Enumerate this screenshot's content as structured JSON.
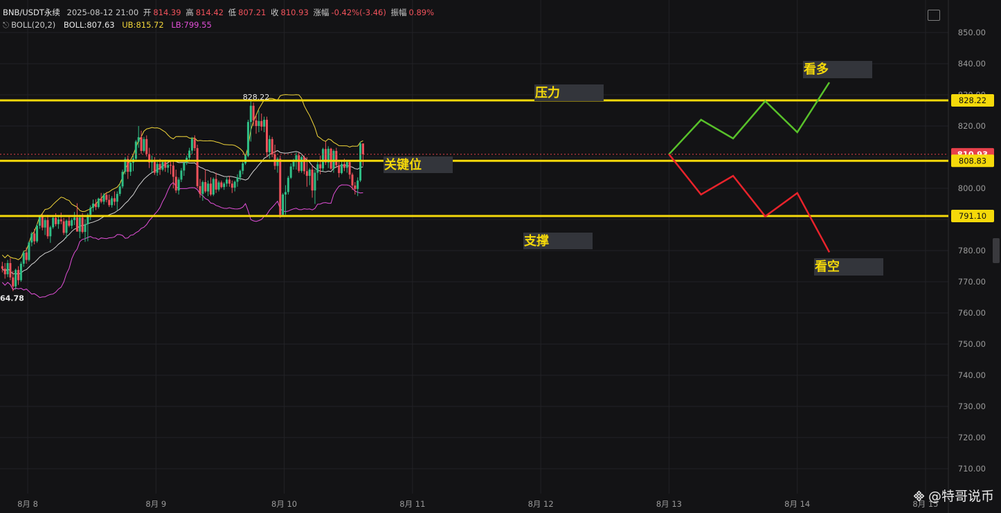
{
  "header": {
    "symbol": "BNB/USDT永续",
    "datetime": "2025-08-12 21:00",
    "open_label": "开",
    "open_value": "814.39",
    "high_label": "高",
    "high_value": "814.42",
    "low_label": "低",
    "low_value": "807.21",
    "close_label": "收",
    "close_value": "810.93",
    "change_label": "涨幅",
    "change_value": "-0.42%(-3.46)",
    "amplitude_label": "振幅",
    "amplitude_value": "0.89%",
    "indicator_name": "BOLL(20,2)",
    "boll_label": "BOLL:",
    "boll_value": "807.63",
    "ub_label": "UB:",
    "ub_value": "815.72",
    "lb_label": "LB:",
    "lb_value": "799.55"
  },
  "watermark": {
    "text": "@特哥说币"
  },
  "colors": {
    "background": "#131315",
    "up": "#2fbd85",
    "down": "#f0525b",
    "boll_mid": "#d4d4d4",
    "boll_upper": "#f2d63a",
    "boll_lower": "#e24fd8",
    "level": "#f5d90a",
    "bull_path": "#58c12a",
    "bear_path": "#e8232b",
    "price_tag": "#e7414b"
  },
  "chart_data": {
    "type": "candlestick",
    "symbol": "BNB/USDT永续",
    "y_axis": {
      "ticks": [
        850,
        840,
        830,
        820,
        810,
        800,
        790,
        780,
        770,
        760,
        750,
        740,
        730,
        720,
        710
      ],
      "tick_labels": [
        "850.00",
        "840.00",
        "830.00",
        "820.00",
        "810.00",
        "800.00",
        "790.00",
        "780.00",
        "770.00",
        "760.00",
        "750.00",
        "740.00",
        "730.00",
        "720.00",
        "710.00"
      ],
      "range": [
        705,
        853
      ]
    },
    "x_axis": {
      "labels": [
        "8月 8",
        "8月 9",
        "8月 10",
        "8月 11",
        "8月 12",
        "8月 13",
        "8月 14",
        "8月 15"
      ],
      "label_times": [
        12,
        60,
        108,
        156,
        204,
        252,
        300,
        348
      ],
      "range_hours": [
        2.5,
        386
      ]
    },
    "grid": true,
    "candles_ohlc": [
      [
        775.0,
        776.4,
        773.0,
        774.2
      ],
      [
        774.2,
        776.0,
        771.0,
        772.4
      ],
      [
        772.4,
        777.0,
        771.5,
        776.0
      ],
      [
        776.0,
        777.6,
        770.5,
        771.4
      ],
      [
        771.4,
        773.5,
        767.0,
        768.5
      ],
      [
        768.5,
        774.2,
        767.5,
        773.8
      ],
      [
        773.8,
        775.0,
        769.0,
        770.5
      ],
      [
        770.5,
        776.5,
        770.0,
        775.8
      ],
      [
        775.8,
        780.0,
        774.8,
        779.4
      ],
      [
        779.4,
        781.0,
        775.8,
        777.0
      ],
      [
        777.0,
        783.0,
        776.5,
        782.6
      ],
      [
        782.6,
        786.0,
        781.4,
        785.5
      ],
      [
        785.5,
        787.0,
        782.0,
        783.0
      ],
      [
        783.0,
        788.5,
        782.5,
        788.0
      ],
      [
        788.0,
        791.5,
        787.0,
        790.9
      ],
      [
        790.9,
        791.8,
        786.5,
        787.4
      ],
      [
        787.4,
        790.5,
        785.0,
        789.8
      ],
      [
        789.8,
        791.5,
        783.8,
        784.6
      ],
      [
        784.6,
        788.0,
        782.5,
        787.5
      ],
      [
        787.5,
        791.0,
        787.0,
        790.5
      ],
      [
        790.5,
        792.0,
        787.8,
        788.5
      ],
      [
        788.5,
        790.8,
        787.0,
        790.0
      ],
      [
        790.0,
        792.2,
        788.5,
        789.4
      ],
      [
        789.4,
        790.5,
        785.0,
        785.7
      ],
      [
        785.7,
        790.0,
        784.0,
        789.6
      ],
      [
        789.6,
        791.4,
        787.5,
        788.0
      ],
      [
        788.0,
        790.4,
        787.0,
        789.8
      ],
      [
        789.8,
        792.4,
        788.2,
        790.6
      ],
      [
        790.6,
        795.2,
        789.6,
        786.1
      ],
      [
        786.1,
        791.5,
        784.0,
        790.6
      ],
      [
        790.6,
        792.0,
        785.5,
        786.0
      ],
      [
        786.0,
        790.0,
        782.8,
        788.5
      ],
      [
        788.5,
        792.0,
        783.0,
        791.5
      ],
      [
        791.5,
        794.5,
        789.8,
        793.8
      ],
      [
        793.8,
        796.4,
        792.5,
        795.1
      ],
      [
        795.1,
        796.5,
        793.0,
        794.0
      ],
      [
        794.0,
        797.0,
        793.5,
        796.7
      ],
      [
        796.7,
        798.5,
        795.2,
        795.7
      ],
      [
        795.7,
        798.5,
        794.8,
        797.9
      ],
      [
        797.9,
        798.8,
        795.5,
        796.3
      ],
      [
        796.3,
        798.0,
        794.0,
        794.6
      ],
      [
        794.6,
        797.5,
        793.8,
        796.8
      ],
      [
        796.8,
        799.0,
        794.5,
        795.7
      ],
      [
        795.7,
        799.0,
        793.0,
        798.2
      ],
      [
        798.2,
        801.5,
        797.5,
        800.6
      ],
      [
        800.6,
        806.0,
        800.0,
        805.3
      ],
      [
        805.3,
        810.0,
        804.5,
        809.4
      ],
      [
        809.4,
        810.5,
        803.0,
        805.3
      ],
      [
        805.3,
        809.0,
        804.0,
        808.2
      ],
      [
        808.2,
        810.5,
        805.5,
        809.5
      ],
      [
        809.5,
        815.5,
        808.5,
        815.0
      ],
      [
        815.0,
        820.0,
        813.0,
        816.4
      ],
      [
        816.4,
        818.5,
        811.0,
        812.0
      ],
      [
        812.0,
        816.5,
        811.5,
        815.8
      ],
      [
        815.8,
        817.0,
        810.2,
        811.0
      ],
      [
        811.0,
        813.0,
        806.5,
        808.3
      ],
      [
        808.3,
        810.5,
        805.0,
        809.0
      ],
      [
        809.0,
        810.0,
        804.3,
        805.0
      ],
      [
        805.0,
        808.5,
        804.0,
        807.8
      ],
      [
        807.8,
        809.5,
        804.3,
        806.0
      ],
      [
        806.0,
        809.0,
        805.5,
        808.4
      ],
      [
        808.4,
        809.2,
        805.3,
        806.6
      ],
      [
        806.6,
        808.0,
        805.0,
        807.5
      ],
      [
        807.5,
        809.0,
        804.5,
        807.3
      ],
      [
        807.3,
        808.8,
        800.0,
        803.7
      ],
      [
        803.7,
        806.0,
        798.5,
        799.3
      ],
      [
        799.3,
        803.5,
        798.0,
        802.8
      ],
      [
        802.8,
        806.5,
        802.0,
        805.7
      ],
      [
        805.7,
        808.5,
        804.0,
        808.2
      ],
      [
        808.2,
        810.5,
        807.5,
        809.8
      ],
      [
        809.8,
        813.0,
        809.0,
        812.1
      ],
      [
        812.1,
        816.5,
        811.0,
        815.9
      ],
      [
        815.9,
        817.0,
        812.0,
        812.9
      ],
      [
        812.9,
        814.0,
        800.0,
        800.7
      ],
      [
        800.7,
        803.0,
        797.0,
        798.2
      ],
      [
        798.2,
        802.5,
        796.0,
        802.0
      ],
      [
        802.0,
        806.0,
        798.5,
        799.0
      ],
      [
        799.0,
        802.5,
        797.5,
        801.5
      ],
      [
        801.5,
        803.5,
        797.5,
        798.0
      ],
      [
        798.0,
        803.5,
        797.5,
        803.0
      ],
      [
        803.0,
        805.0,
        798.5,
        799.6
      ],
      [
        799.6,
        802.5,
        799.0,
        801.9
      ],
      [
        801.9,
        802.5,
        800.0,
        800.4
      ],
      [
        800.4,
        802.0,
        799.5,
        801.5
      ],
      [
        801.5,
        803.5,
        800.5,
        802.8
      ],
      [
        802.8,
        804.0,
        800.5,
        801.5
      ],
      [
        801.5,
        802.5,
        798.5,
        800.2
      ],
      [
        800.2,
        802.5,
        799.0,
        802.1
      ],
      [
        802.1,
        804.5,
        800.5,
        803.5
      ],
      [
        803.5,
        806.0,
        802.5,
        805.6
      ],
      [
        805.6,
        808.5,
        804.5,
        808.0
      ],
      [
        808.0,
        811.0,
        807.5,
        810.4
      ],
      [
        810.4,
        822.0,
        810.0,
        821.3
      ],
      [
        821.3,
        828.22,
        815.0,
        826.5
      ],
      [
        826.5,
        827.5,
        820.0,
        821.8
      ],
      [
        821.8,
        823.5,
        817.5,
        820.0
      ],
      [
        820.0,
        825.0,
        818.0,
        821.6
      ],
      [
        821.6,
        824.0,
        818.5,
        819.8
      ],
      [
        819.8,
        823.0,
        818.0,
        822.0
      ],
      [
        822.0,
        823.0,
        810.0,
        811.6
      ],
      [
        811.6,
        817.0,
        809.5,
        815.8
      ],
      [
        815.8,
        816.5,
        810.0,
        810.9
      ],
      [
        810.9,
        814.0,
        806.0,
        807.2
      ],
      [
        807.2,
        810.0,
        805.0,
        809.5
      ],
      [
        809.5,
        810.5,
        790.5,
        791.5
      ],
      [
        791.5,
        798.5,
        791.0,
        798.0
      ],
      [
        798.0,
        801.0,
        791.5,
        798.8
      ],
      [
        798.8,
        804.0,
        798.0,
        803.4
      ],
      [
        803.4,
        808.0,
        803.0,
        807.0
      ],
      [
        807.0,
        809.5,
        806.0,
        808.6
      ],
      [
        808.6,
        811.5,
        806.0,
        810.6
      ],
      [
        810.6,
        811.5,
        805.0,
        805.6
      ],
      [
        805.6,
        810.5,
        805.0,
        810.0
      ],
      [
        810.0,
        810.5,
        804.5,
        805.5
      ],
      [
        805.5,
        810.0,
        800.5,
        804.0
      ],
      [
        804.0,
        806.5,
        801.0,
        806.0
      ],
      [
        806.0,
        807.5,
        797.0,
        799.3
      ],
      [
        799.3,
        806.0,
        795.0,
        805.0
      ],
      [
        805.0,
        808.5,
        802.5,
        807.7
      ],
      [
        807.7,
        810.5,
        804.5,
        806.4
      ],
      [
        806.4,
        813.0,
        805.5,
        812.6
      ],
      [
        812.6,
        815.0,
        807.5,
        808.3
      ],
      [
        808.3,
        813.5,
        806.5,
        812.7
      ],
      [
        812.7,
        813.0,
        806.0,
        806.3
      ],
      [
        806.3,
        812.5,
        805.0,
        812.0
      ],
      [
        812.0,
        813.0,
        806.5,
        807.4
      ],
      [
        807.4,
        808.5,
        803.5,
        804.9
      ],
      [
        804.9,
        809.0,
        804.5,
        807.8
      ],
      [
        807.8,
        809.5,
        805.5,
        806.6
      ],
      [
        806.6,
        809.0,
        805.0,
        808.4
      ],
      [
        808.4,
        809.0,
        803.0,
        804.4
      ],
      [
        804.4,
        805.0,
        799.5,
        800.9
      ],
      [
        800.9,
        802.0,
        798.0,
        799.8
      ],
      [
        799.8,
        803.5,
        797.5,
        802.5
      ],
      [
        802.5,
        815.0,
        802.0,
        814.39
      ],
      [
        814.39,
        814.42,
        807.21,
        810.93
      ]
    ],
    "bollinger": {
      "period": 20,
      "multiplier": 2,
      "mid_current": 807.63,
      "upper_current": 815.72,
      "lower_current": 799.55
    },
    "annotations": [
      {
        "label": "压力",
        "price": 828.22,
        "kind": "resistance"
      },
      {
        "label": "关键位",
        "price": 808.83,
        "kind": "key"
      },
      {
        "label": "支撑",
        "price": 791.1,
        "kind": "support"
      },
      {
        "label": "看多",
        "kind": "bullish_path",
        "points": [
          [
            252,
            810.93
          ],
          [
            264,
            822.0
          ],
          [
            276,
            816.0
          ],
          [
            288,
            828.0
          ],
          [
            300,
            818.0
          ],
          [
            312,
            834.0
          ]
        ]
      },
      {
        "label": "看空",
        "kind": "bearish_path",
        "points": [
          [
            252,
            810.93
          ],
          [
            264,
            798.0
          ],
          [
            276,
            804.0
          ],
          [
            288,
            791.0
          ],
          [
            300,
            798.5
          ],
          [
            312,
            779.5
          ]
        ]
      }
    ],
    "price_marks": {
      "high_label": "828.22",
      "low_label": "64.78"
    },
    "price_tags": [
      "828.22",
      "810.93",
      "808.83",
      "791.10"
    ]
  }
}
